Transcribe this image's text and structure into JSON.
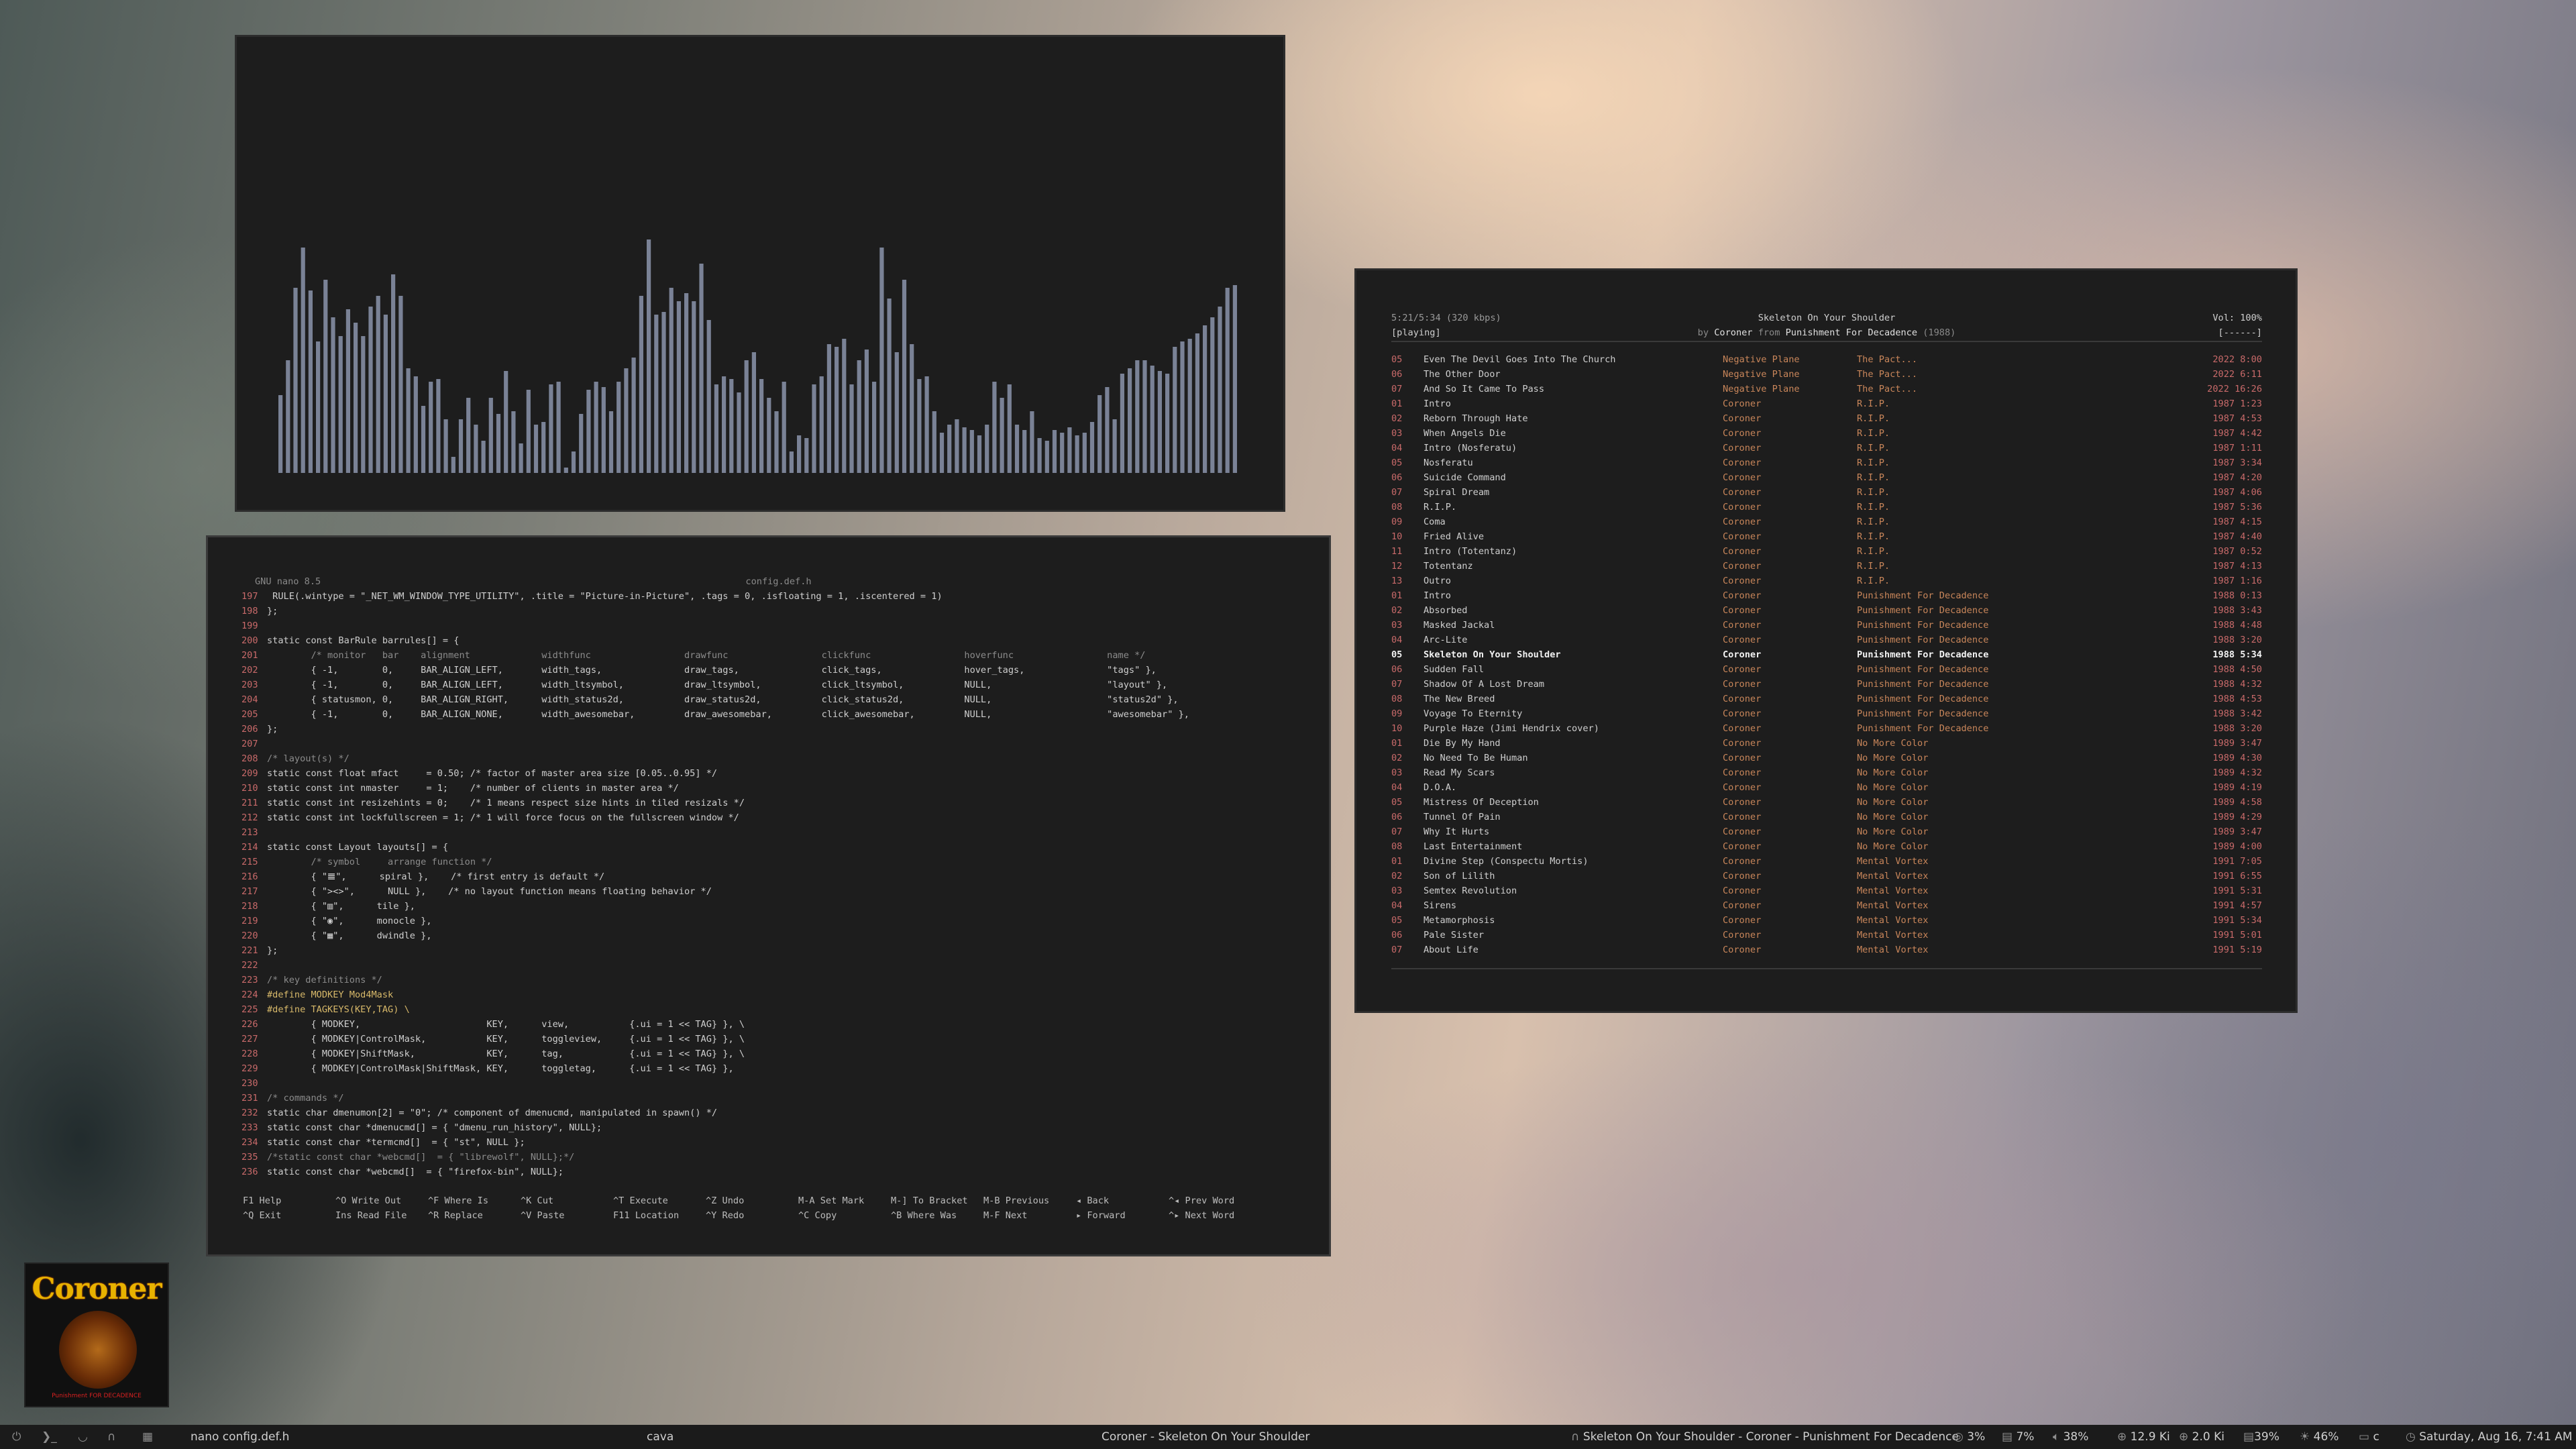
{
  "cava": {
    "bar_levels": [
      0.29,
      0.42,
      0.69,
      0.84,
      0.68,
      0.49,
      0.72,
      0.58,
      0.51,
      0.61,
      0.56,
      0.51,
      0.62,
      0.66,
      0.59,
      0.74,
      0.66,
      0.39,
      0.36,
      0.25,
      0.34,
      0.35,
      0.2,
      0.06,
      0.2,
      0.28,
      0.18,
      0.12,
      0.28,
      0.22,
      0.38,
      0.23,
      0.11,
      0.31,
      0.18,
      0.19,
      0.33,
      0.34,
      0.02,
      0.08,
      0.22,
      0.31,
      0.34,
      0.32,
      0.23,
      0.34,
      0.39,
      0.43,
      0.66,
      0.87,
      0.59,
      0.6,
      0.69,
      0.64,
      0.67,
      0.64,
      0.78,
      0.57,
      0.33,
      0.36,
      0.35,
      0.3,
      0.42,
      0.45,
      0.35,
      0.28,
      0.23,
      0.34,
      0.08,
      0.14,
      0.13,
      0.33,
      0.36,
      0.48,
      0.47,
      0.5,
      0.33,
      0.42,
      0.46,
      0.34,
      0.84,
      0.65,
      0.45,
      0.72,
      0.48,
      0.35,
      0.36,
      0.23,
      0.15,
      0.18,
      0.2,
      0.17,
      0.16,
      0.14,
      0.18,
      0.34,
      0.28,
      0.33,
      0.18,
      0.16,
      0.23,
      0.13,
      0.12,
      0.16,
      0.15,
      0.17,
      0.14,
      0.15,
      0.19,
      0.29,
      0.32,
      0.2,
      0.37,
      0.39,
      0.42,
      0.42,
      0.4,
      0.38,
      0.37,
      0.47,
      0.49,
      0.5,
      0.52,
      0.55,
      0.58,
      0.62,
      0.69,
      0.7
    ]
  },
  "nano": {
    "version": "GNU nano 8.5",
    "filename": "config.def.h",
    "lines": [
      {
        "no": "197",
        "text": " RULE(.wintype = \"_NET_WM_WINDOW_TYPE_UTILITY\", .title = \"Picture-in-Picture\", .tags = 0, .isfloating = 1, .iscentered = 1)"
      },
      {
        "no": "198",
        "text": "};"
      },
      {
        "no": "199",
        "text": ""
      },
      {
        "no": "200",
        "text": "static const BarRule barrules[] = {"
      },
      {
        "no": "201",
        "text": "        /* monitor   bar    alignment             widthfunc                 drawfunc                 clickfunc                 hoverfunc                 name */"
      },
      {
        "no": "202",
        "text": "        { -1,        0,     BAR_ALIGN_LEFT,       width_tags,               draw_tags,               click_tags,               hover_tags,               \"tags\" },"
      },
      {
        "no": "203",
        "text": "        { -1,        0,     BAR_ALIGN_LEFT,       width_ltsymbol,           draw_ltsymbol,           click_ltsymbol,           NULL,                     \"layout\" },"
      },
      {
        "no": "204",
        "text": "        { statusmon, 0,     BAR_ALIGN_RIGHT,      width_status2d,           draw_status2d,           click_status2d,           NULL,                     \"status2d\" },"
      },
      {
        "no": "205",
        "text": "        { -1,        0,     BAR_ALIGN_NONE,       width_awesomebar,         draw_awesomebar,         click_awesomebar,         NULL,                     \"awesomebar\" },"
      },
      {
        "no": "206",
        "text": "};"
      },
      {
        "no": "207",
        "text": ""
      },
      {
        "no": "208",
        "text": "/* layout(s) */"
      },
      {
        "no": "209",
        "text": "static const float mfact     = 0.50; /* factor of master area size [0.05..0.95] */"
      },
      {
        "no": "210",
        "text": "static const int nmaster     = 1;    /* number of clients in master area */"
      },
      {
        "no": "211",
        "text": "static const int resizehints = 0;    /* 1 means respect size hints in tiled resizals */"
      },
      {
        "no": "212",
        "text": "static const int lockfullscreen = 1; /* 1 will force focus on the fullscreen window */"
      },
      {
        "no": "213",
        "text": ""
      },
      {
        "no": "214",
        "text": "static const Layout layouts[] = {"
      },
      {
        "no": "215",
        "text": "        /* symbol     arrange function */"
      },
      {
        "no": "216",
        "text": "        { \"𝌆\",      spiral },    /* first entry is default */"
      },
      {
        "no": "217",
        "text": "        { \"><>\",      NULL },    /* no layout function means floating behavior */"
      },
      {
        "no": "218",
        "text": "        { \"▥\",      tile },"
      },
      {
        "no": "219",
        "text": "        { \"◉\",      monocle },"
      },
      {
        "no": "220",
        "text": "        { \"▦\",      dwindle },"
      },
      {
        "no": "221",
        "text": "};"
      },
      {
        "no": "222",
        "text": ""
      },
      {
        "no": "223",
        "text": "/* key definitions */"
      },
      {
        "no": "224",
        "text": "#define MODKEY Mod4Mask"
      },
      {
        "no": "225",
        "text": "#define TAGKEYS(KEY,TAG) \\"
      },
      {
        "no": "226",
        "text": "        { MODKEY,                       KEY,      view,           {.ui = 1 << TAG} }, \\"
      },
      {
        "no": "227",
        "text": "        { MODKEY|ControlMask,           KEY,      toggleview,     {.ui = 1 << TAG} }, \\"
      },
      {
        "no": "228",
        "text": "        { MODKEY|ShiftMask,             KEY,      tag,            {.ui = 1 << TAG} }, \\"
      },
      {
        "no": "229",
        "text": "        { MODKEY|ControlMask|ShiftMask, KEY,      toggletag,      {.ui = 1 << TAG} },"
      },
      {
        "no": "230",
        "text": ""
      },
      {
        "no": "231",
        "text": "/* commands */"
      },
      {
        "no": "232",
        "text": "static char dmenumon[2] = \"0\"; /* component of dmenucmd, manipulated in spawn() */"
      },
      {
        "no": "233",
        "text": "static const char *dmenucmd[] = { \"dmenu_run_history\", NULL};"
      },
      {
        "no": "234",
        "text": "static const char *termcmd[]  = { \"st\", NULL };"
      },
      {
        "no": "235",
        "text": "/*static const char *webcmd[]  = { \"librewolf\", NULL};*/"
      },
      {
        "no": "236",
        "text": "static const char *webcmd[]  = { \"firefox-bin\", NULL};"
      }
    ],
    "help_row1": [
      "F1 Help",
      "^O Write Out",
      "^F Where Is",
      "^K Cut",
      "^T Execute",
      "^Z Undo",
      "M-A Set Mark",
      "M-] To Bracket",
      "M-B Previous",
      "◂ Back",
      "^◂ Prev Word"
    ],
    "help_row2": [
      "^Q Exit",
      "Ins Read File",
      "^R Replace",
      "^V Paste",
      "F11 Location",
      "^Y Redo",
      "^C Copy",
      "^B Where Was",
      "M-F Next",
      "▸ Forward",
      "^▸ Next Word"
    ]
  },
  "cmus": {
    "time": "5:21/5:34 (320 kbps)",
    "status": "[playing]",
    "now_title": "Skeleton On Your Shoulder",
    "by": "by",
    "now_artist": "Coroner",
    "from": "from",
    "now_album": "Punishment For Decadence",
    "now_year": "(1988)",
    "vol": "Vol: 100%",
    "mode": "[------]",
    "tracks": [
      {
        "n": "05",
        "title": "Even The Devil Goes Into The Church",
        "artist": "Negative Plane",
        "album": "The Pact...",
        "year": "2022 8:00"
      },
      {
        "n": "06",
        "title": "The Other Door",
        "artist": "Negative Plane",
        "album": "The Pact...",
        "year": "2022 6:11"
      },
      {
        "n": "07",
        "title": "And So It Came To Pass",
        "artist": "Negative Plane",
        "album": "The Pact...",
        "year": "2022 16:26"
      },
      {
        "n": "01",
        "title": "Intro",
        "artist": "Coroner",
        "album": "R.I.P.",
        "year": "1987 1:23"
      },
      {
        "n": "02",
        "title": "Reborn Through Hate",
        "artist": "Coroner",
        "album": "R.I.P.",
        "year": "1987 4:53"
      },
      {
        "n": "03",
        "title": "When Angels Die",
        "artist": "Coroner",
        "album": "R.I.P.",
        "year": "1987 4:42"
      },
      {
        "n": "04",
        "title": "Intro (Nosferatu)",
        "artist": "Coroner",
        "album": "R.I.P.",
        "year": "1987 1:11"
      },
      {
        "n": "05",
        "title": "Nosferatu",
        "artist": "Coroner",
        "album": "R.I.P.",
        "year": "1987 3:34"
      },
      {
        "n": "06",
        "title": "Suicide Command",
        "artist": "Coroner",
        "album": "R.I.P.",
        "year": "1987 4:20"
      },
      {
        "n": "07",
        "title": "Spiral Dream",
        "artist": "Coroner",
        "album": "R.I.P.",
        "year": "1987 4:06"
      },
      {
        "n": "08",
        "title": "R.I.P.",
        "artist": "Coroner",
        "album": "R.I.P.",
        "year": "1987 5:36"
      },
      {
        "n": "09",
        "title": "Coma",
        "artist": "Coroner",
        "album": "R.I.P.",
        "year": "1987 4:15"
      },
      {
        "n": "10",
        "title": "Fried Alive",
        "artist": "Coroner",
        "album": "R.I.P.",
        "year": "1987 4:40"
      },
      {
        "n": "11",
        "title": "Intro (Totentanz)",
        "artist": "Coroner",
        "album": "R.I.P.",
        "year": "1987 0:52"
      },
      {
        "n": "12",
        "title": "Totentanz",
        "artist": "Coroner",
        "album": "R.I.P.",
        "year": "1987 4:13"
      },
      {
        "n": "13",
        "title": "Outro",
        "artist": "Coroner",
        "album": "R.I.P.",
        "year": "1987 1:16"
      },
      {
        "n": "01",
        "title": "Intro",
        "artist": "Coroner",
        "album": "Punishment For Decadence",
        "year": "1988 0:13"
      },
      {
        "n": "02",
        "title": "Absorbed",
        "artist": "Coroner",
        "album": "Punishment For Decadence",
        "year": "1988 3:43"
      },
      {
        "n": "03",
        "title": "Masked Jackal",
        "artist": "Coroner",
        "album": "Punishment For Decadence",
        "year": "1988 4:48"
      },
      {
        "n": "04",
        "title": "Arc-Lite",
        "artist": "Coroner",
        "album": "Punishment For Decadence",
        "year": "1988 3:20"
      },
      {
        "n": "05",
        "title": "Skeleton On Your Shoulder",
        "artist": "Coroner",
        "album": "Punishment For Decadence",
        "year": "1988 5:34",
        "current": true
      },
      {
        "n": "06",
        "title": "Sudden Fall",
        "artist": "Coroner",
        "album": "Punishment For Decadence",
        "year": "1988 4:50"
      },
      {
        "n": "07",
        "title": "Shadow Of A Lost Dream",
        "artist": "Coroner",
        "album": "Punishment For Decadence",
        "year": "1988 4:32"
      },
      {
        "n": "08",
        "title": "The New Breed",
        "artist": "Coroner",
        "album": "Punishment For Decadence",
        "year": "1988 4:53"
      },
      {
        "n": "09",
        "title": "Voyage To Eternity",
        "artist": "Coroner",
        "album": "Punishment For Decadence",
        "year": "1988 3:42"
      },
      {
        "n": "10",
        "title": "Purple Haze (Jimi Hendrix cover)",
        "artist": "Coroner",
        "album": "Punishment For Decadence",
        "year": "1988 3:20"
      },
      {
        "n": "01",
        "title": "Die By My Hand",
        "artist": "Coroner",
        "album": "No More Color",
        "year": "1989 3:47"
      },
      {
        "n": "02",
        "title": "No Need To Be Human",
        "artist": "Coroner",
        "album": "No More Color",
        "year": "1989 4:30"
      },
      {
        "n": "03",
        "title": "Read My Scars",
        "artist": "Coroner",
        "album": "No More Color",
        "year": "1989 4:32"
      },
      {
        "n": "04",
        "title": "D.O.A.",
        "artist": "Coroner",
        "album": "No More Color",
        "year": "1989 4:19"
      },
      {
        "n": "05",
        "title": "Mistress Of Deception",
        "artist": "Coroner",
        "album": "No More Color",
        "year": "1989 4:58"
      },
      {
        "n": "06",
        "title": "Tunnel Of Pain",
        "artist": "Coroner",
        "album": "No More Color",
        "year": "1989 4:29"
      },
      {
        "n": "07",
        "title": "Why It Hurts",
        "artist": "Coroner",
        "album": "No More Color",
        "year": "1989 3:47"
      },
      {
        "n": "08",
        "title": "Last Entertainment",
        "artist": "Coroner",
        "album": "No More Color",
        "year": "1989 4:00"
      },
      {
        "n": "01",
        "title": "Divine Step (Conspectu Mortis)",
        "artist": "Coroner",
        "album": "Mental Vortex",
        "year": "1991 7:05"
      },
      {
        "n": "02",
        "title": "Son of Lilith",
        "artist": "Coroner",
        "album": "Mental Vortex",
        "year": "1991 6:55"
      },
      {
        "n": "03",
        "title": "Semtex Revolution",
        "artist": "Coroner",
        "album": "Mental Vortex",
        "year": "1991 5:31"
      },
      {
        "n": "04",
        "title": "Sirens",
        "artist": "Coroner",
        "album": "Mental Vortex",
        "year": "1991 4:57"
      },
      {
        "n": "05",
        "title": "Metamorphosis",
        "artist": "Coroner",
        "album": "Mental Vortex",
        "year": "1991 5:34"
      },
      {
        "n": "06",
        "title": "Pale Sister",
        "artist": "Coroner",
        "album": "Mental Vortex",
        "year": "1991 5:01"
      },
      {
        "n": "07",
        "title": "About Life",
        "artist": "Coroner",
        "album": "Mental Vortex",
        "year": "1991 5:19"
      }
    ]
  },
  "albumart": {
    "logo": "Coroner",
    "caption": "Punishment FOR DECADENCE"
  },
  "bar": {
    "window_nano": "nano config.def.h",
    "window_cava": "cava",
    "window_title": "Coroner - Skeleton On Your Shoulder",
    "now_playing": "Skeleton On Your Shoulder - Coroner - Punishment For Decadence",
    "cpu": "3%",
    "mem": "7%",
    "volume": "38%",
    "net_down": "12.9 Ki",
    "net_up": "2.0 Ki",
    "disk": "39%",
    "brightness": "46%",
    "kbd": "c",
    "datetime": "Saturday, Aug 16, 7:41 AM"
  },
  "colors": {
    "bar_color": "#7a8296",
    "line_no": "#c96a6a",
    "artist": "#c9865a",
    "window_bg": "#1d1d1d"
  }
}
